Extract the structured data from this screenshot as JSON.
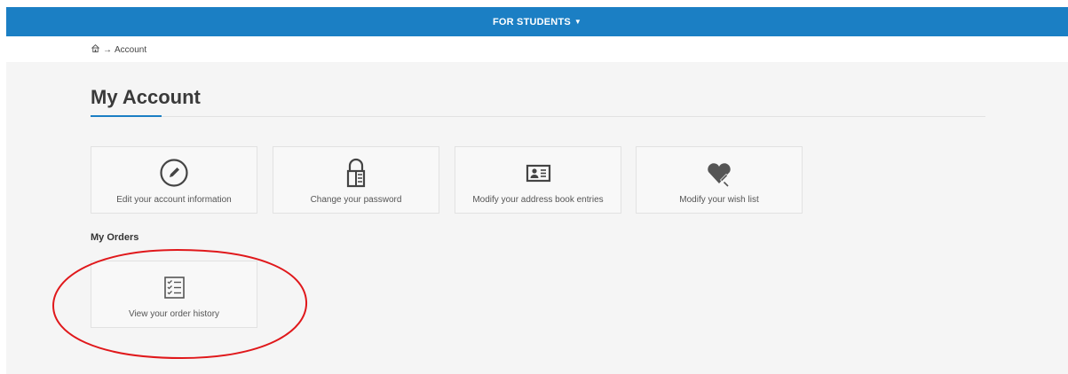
{
  "topbar": {
    "menu_label": "FOR STUDENTS"
  },
  "breadcrumb": {
    "arrow": "→",
    "current": "Account"
  },
  "page": {
    "title": "My Account"
  },
  "account_actions": [
    {
      "label": "Edit your account information",
      "icon": "pencil-circle-icon"
    },
    {
      "label": "Change your password",
      "icon": "padlock-icon"
    },
    {
      "label": "Modify your address book entries",
      "icon": "address-card-icon"
    },
    {
      "label": "Modify your wish list",
      "icon": "heart-edit-icon"
    }
  ],
  "orders": {
    "title": "My Orders",
    "items": [
      {
        "label": "View your order history",
        "icon": "checklist-icon"
      }
    ]
  },
  "colors": {
    "accent": "#1b7fc4",
    "annotation": "#e0181b",
    "background": "#f5f5f5"
  }
}
